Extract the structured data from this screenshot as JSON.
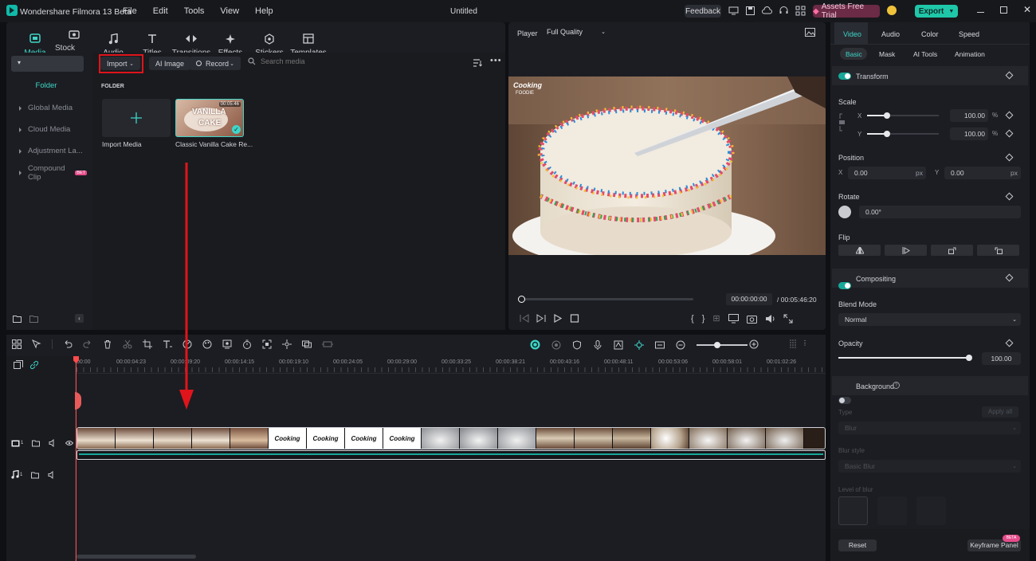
{
  "app": {
    "title": "Wondershare Filmora 13 Beta",
    "doc_title": "Untitled"
  },
  "menu": [
    "File",
    "Edit",
    "Tools",
    "View",
    "Help"
  ],
  "titlebar": {
    "feedback": "Feedback",
    "assets": "Assets Free Trial",
    "export": "Export"
  },
  "media_tabs": [
    {
      "label": "Media",
      "icon": "media-icon"
    },
    {
      "label": "Stock Media",
      "icon": "stock-media-icon"
    },
    {
      "label": "Audio",
      "icon": "audio-note-icon"
    },
    {
      "label": "Titles",
      "icon": "titles-icon"
    },
    {
      "label": "Transitions",
      "icon": "transitions-icon"
    },
    {
      "label": "Effects",
      "icon": "effects-icon"
    },
    {
      "label": "Stickers",
      "icon": "stickers-icon"
    },
    {
      "label": "Templates",
      "icon": "templates-icon"
    }
  ],
  "sidebar": {
    "folder": "Folder",
    "items": [
      "Global Media",
      "Cloud Media",
      "Adjustment La...",
      "Compound Clip"
    ],
    "compound_badge": "BET"
  },
  "media_toolbar": {
    "import": "Import",
    "ai_image": "AI Image",
    "record": "Record",
    "search_placeholder": "Search media"
  },
  "media_area": {
    "folder_label": "FOLDER",
    "import_media": "Import Media",
    "clip_name": "Classic Vanilla Cake Re...",
    "clip_duration": "00:05:46",
    "thumb_text_1": "VANILLA",
    "thumb_text_2": "CAKE"
  },
  "player": {
    "label": "Player",
    "quality": "Full Quality",
    "current_time": "00:00:00:00",
    "total_time": "/ 00:05:46:20",
    "watermark_1": "Cooking",
    "watermark_2": "FOODIE",
    "progress": 0
  },
  "right_panel": {
    "tabs": [
      "Video",
      "Audio",
      "Color",
      "Speed"
    ],
    "subtabs": [
      "Basic",
      "Mask",
      "AI Tools",
      "Animation"
    ],
    "transform": "Transform",
    "scale": "Scale",
    "scale_x": "100.00",
    "scale_y": "100.00",
    "pct": "%",
    "x": "X",
    "y": "Y",
    "position": "Position",
    "pos_x": "0.00",
    "pos_y": "0.00",
    "px": "px",
    "rotate": "Rotate",
    "rotate_val": "0.00°",
    "flip": "Flip",
    "compositing": "Compositing",
    "blend_mode": "Blend Mode",
    "blend_value": "Normal",
    "opacity": "Opacity",
    "opacity_val": "100.00",
    "background": "Background",
    "type": "Type",
    "apply_all": "Apply all",
    "type_value": "Blur",
    "blur_style": "Blur style",
    "blur_style_value": "Basic Blur",
    "level_of_blur": "Level of blur",
    "reset": "Reset",
    "keyframe_panel": "Keyframe Panel",
    "beta": "BETA"
  },
  "timeline": {
    "ruler": [
      "00:00",
      "00:00:04:23",
      "00:00:09:20",
      "00:00:14:15",
      "00:00:19:10",
      "00:00:24:05",
      "00:00:29:00",
      "00:00:33:25",
      "00:00:38:21",
      "00:00:43:16",
      "00:00:48:11",
      "00:00:53:06",
      "00:00:58:01",
      "00:01:02:26"
    ],
    "video_track_num": "1",
    "audio_track_num": "1",
    "logo_text": "Cooking"
  },
  "colors": {
    "accent": "#3ed5c8",
    "export": "#1fc7a9",
    "highlight": "#e0141b",
    "playhead": "#ff4a4a"
  }
}
